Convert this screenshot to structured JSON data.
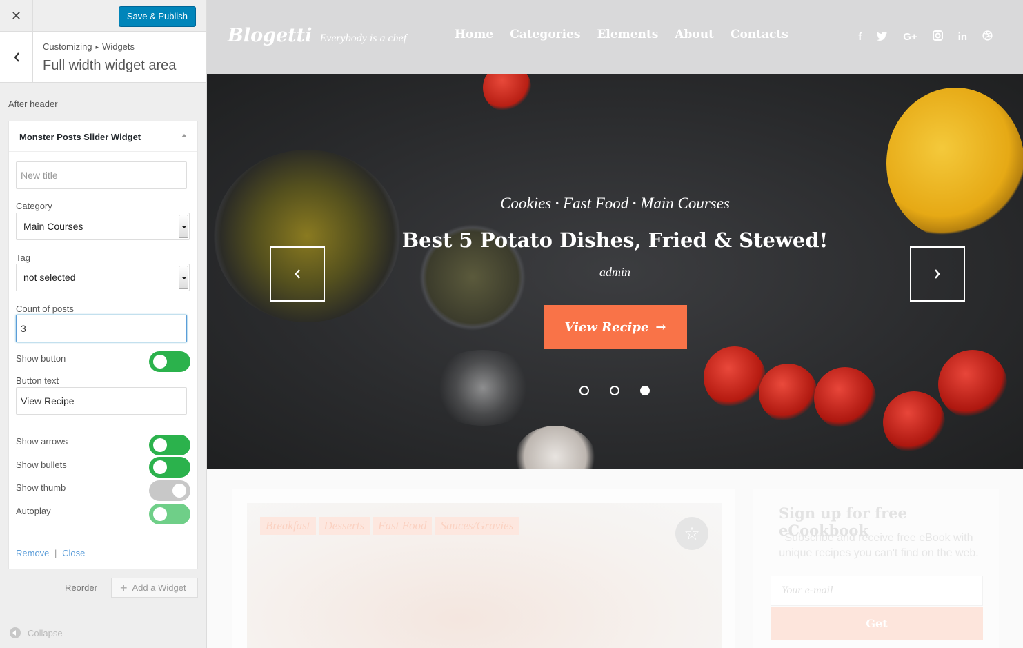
{
  "customizer": {
    "close_icon": "close-icon",
    "publish_label": "Save & Publish",
    "breadcrumb": {
      "root": "Customizing",
      "child": "Widgets"
    },
    "panel_title": "Full width widget area",
    "section_label": "After header",
    "widget": {
      "name": "Monster Posts Slider Widget",
      "title_placeholder": "New title",
      "category_label": "Category",
      "category_value": "Main Courses",
      "tag_label": "Tag",
      "tag_value": "not selected",
      "count_label": "Count of posts",
      "count_value": "3",
      "show_button_label": "Show button",
      "show_button": true,
      "button_text_label": "Button text",
      "button_text_value": "View Recipe",
      "show_arrows_label": "Show arrows",
      "show_arrows": true,
      "show_bullets_label": "Show bullets",
      "show_bullets": true,
      "show_thumb_label": "Show thumb",
      "show_thumb": false,
      "autoplay_label": "Autoplay",
      "autoplay": true,
      "remove_label": "Remove",
      "link_separator": "|",
      "close_label": "Close"
    },
    "reorder_label": "Reorder",
    "add_widget_label": "Add a Widget",
    "collapse_label": "Collapse"
  },
  "site": {
    "brand": "Blogetti",
    "tagline": "Everybody is a chef",
    "nav": [
      "Home",
      "Categories",
      "Elements",
      "About",
      "Contacts"
    ],
    "social": [
      {
        "icon": "facebook-icon",
        "glyph": "f"
      },
      {
        "icon": "twitter-icon",
        "glyph": "t"
      },
      {
        "icon": "google-plus-icon",
        "glyph": "G+"
      },
      {
        "icon": "instagram-icon",
        "glyph": "◘"
      },
      {
        "icon": "linkedin-icon",
        "glyph": "in"
      },
      {
        "icon": "dribbble-icon",
        "glyph": "◎"
      }
    ],
    "slider": {
      "categories": [
        "Cookies",
        "Fast Food",
        "Main Courses"
      ],
      "title": "Best 5 Potato Dishes, Fried & Stewed!",
      "author": "admin",
      "button_label": "View Recipe",
      "bullets_count": 3,
      "active_bullet": 3
    },
    "post_card": {
      "tags": [
        "Breakfast",
        "Desserts",
        "Fast Food",
        "Sauces/Gravies"
      ]
    },
    "signup": {
      "title": "Sign up for free eCookbook",
      "text": "Subscribe and receive free eBook with unique recipes you can't find on the web.",
      "email_placeholder": "Your e-mail",
      "button_label": "Get"
    },
    "colors": {
      "accent": "#f97348",
      "publish": "#0085ba",
      "toggle_on": "#2bb24c"
    }
  }
}
